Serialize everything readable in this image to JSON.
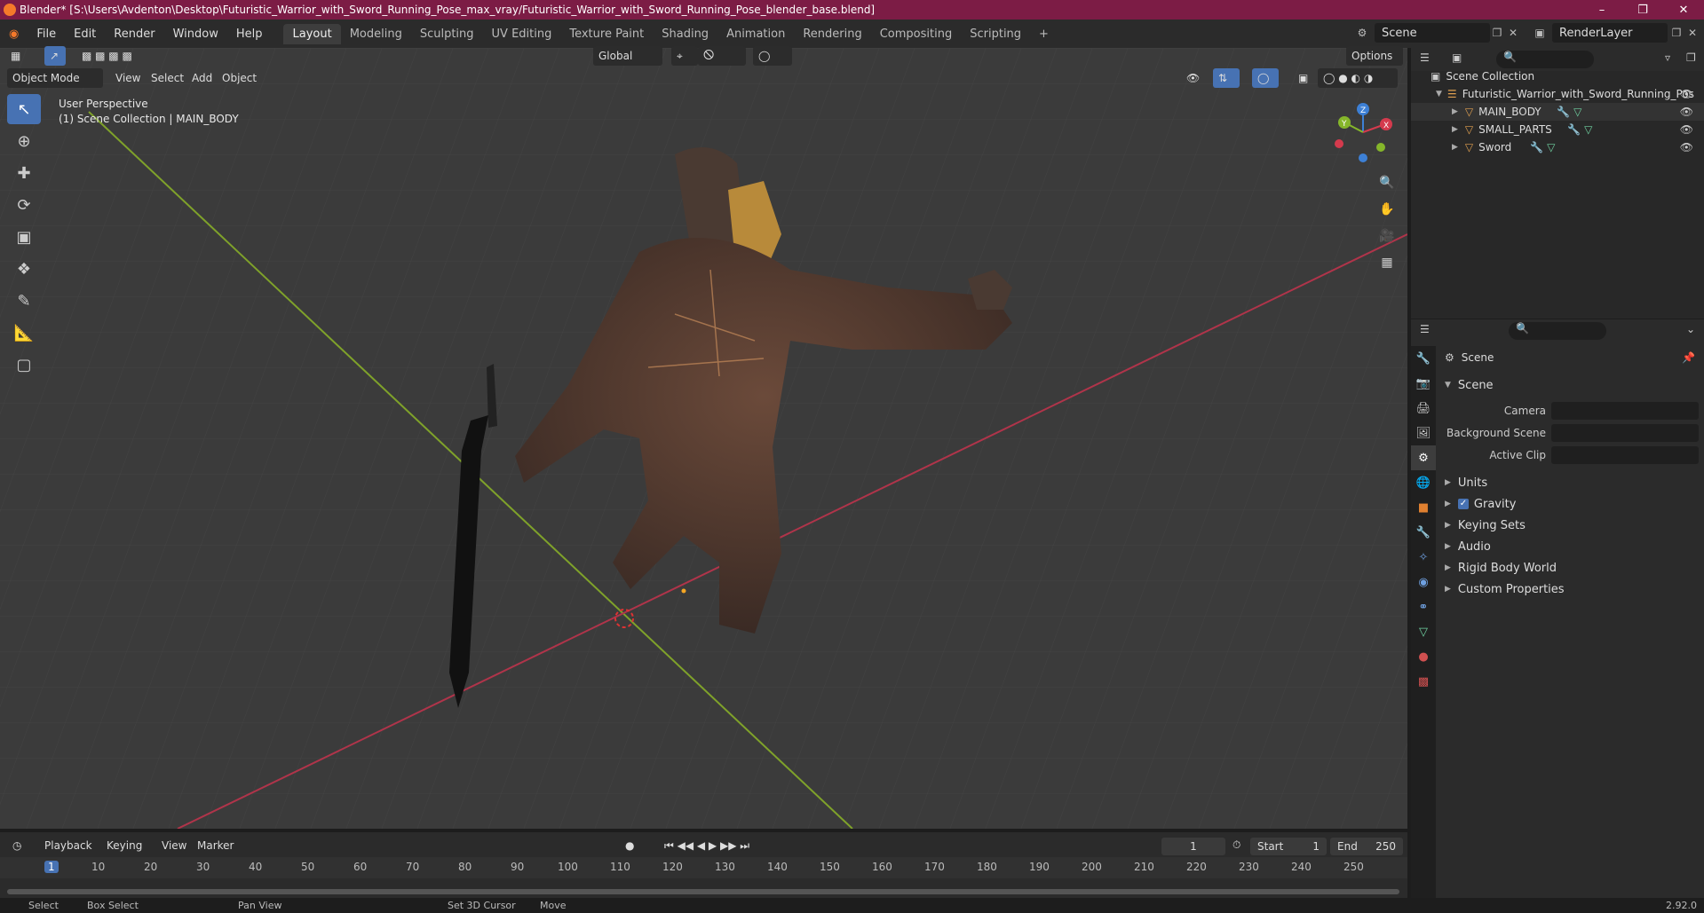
{
  "title_bar": {
    "text": "Blender* [S:\\Users\\Avdenton\\Desktop\\Futuristic_Warrior_with_Sword_Running_Pose_max_vray/Futuristic_Warrior_with_Sword_Running_Pose_blender_base.blend]"
  },
  "menu": {
    "items": [
      "File",
      "Edit",
      "Render",
      "Window",
      "Help"
    ]
  },
  "workspace_tabs": [
    "Layout",
    "Modeling",
    "Sculpting",
    "UV Editing",
    "Texture Paint",
    "Shading",
    "Animation",
    "Rendering",
    "Compositing",
    "Scripting"
  ],
  "workspace_active": "Layout",
  "scene": {
    "name": "Scene",
    "render_layer": "RenderLayer"
  },
  "viewport": {
    "mode": "Object Mode",
    "menus": [
      "View",
      "Select",
      "Add",
      "Object"
    ],
    "transform": "Global",
    "options": "Options",
    "overlay_line1": "User Perspective",
    "overlay_line2": "(1) Scene Collection | MAIN_BODY",
    "gizmo": {
      "x": "X",
      "y": "Y",
      "z": "Z"
    }
  },
  "timeline": {
    "menus": [
      "Playback",
      "Keying",
      "View",
      "Marker"
    ],
    "current_frame": "1",
    "start_label": "Start",
    "start": "1",
    "end_label": "End",
    "end": "250",
    "ruler": [
      "1",
      "10",
      "20",
      "30",
      "40",
      "50",
      "60",
      "70",
      "80",
      "90",
      "100",
      "110",
      "120",
      "130",
      "140",
      "150",
      "160",
      "170",
      "180",
      "190",
      "200",
      "210",
      "220",
      "230",
      "240",
      "250"
    ]
  },
  "status": {
    "select": "Select",
    "box_select": "Box Select",
    "pan": "Pan View",
    "cursor": "Set 3D Cursor",
    "move": "Move",
    "version": "2.92.0"
  },
  "outliner": {
    "root": "Scene Collection",
    "collection": "Futuristic_Warrior_with_Sword_Running_Pos",
    "objects": [
      "MAIN_BODY",
      "SMALL_PARTS",
      "Sword"
    ]
  },
  "properties": {
    "context": "Scene",
    "panel": "Scene",
    "camera_label": "Camera",
    "bg_scene_label": "Background Scene",
    "active_clip_label": "Active Clip",
    "subpanels": [
      "Units",
      "Gravity",
      "Keying Sets",
      "Audio",
      "Rigid Body World",
      "Custom Properties"
    ]
  },
  "colors": {
    "accent": "#4772b3",
    "title": "#7c1c45",
    "x_axis": "#d43a4d",
    "y_axis": "#85b62a",
    "z_axis": "#3d80d6"
  }
}
